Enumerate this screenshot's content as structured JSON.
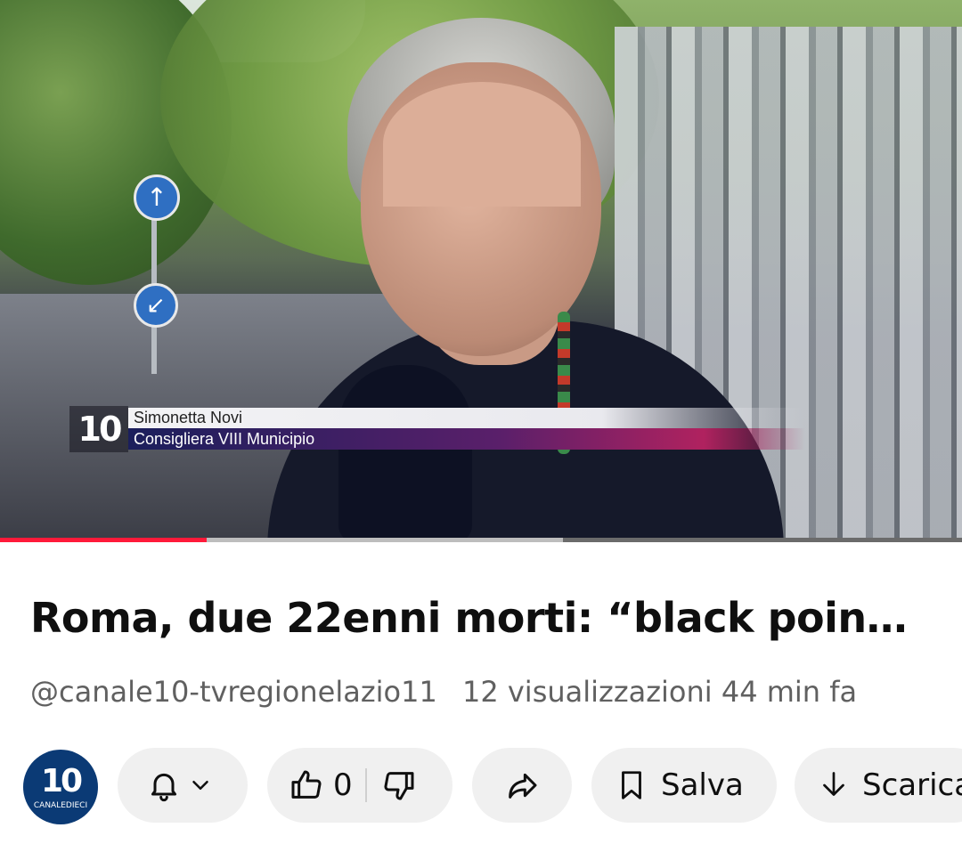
{
  "video": {
    "lower_third": {
      "logo": "10",
      "name": "Simonetta Novi",
      "role": "Consigliera VIII Municipio"
    },
    "progress": {
      "played": 0.215,
      "buffered": 0.585
    }
  },
  "title": "Roma, due 22enni morti: “black poin…",
  "meta": {
    "channel": "@canale10-tvregionelazio11",
    "views": "12 visualizzazioni",
    "time": "44 min fa"
  },
  "channel_avatar": {
    "logo": "10",
    "caption": "CANALEDIECI"
  },
  "actions": {
    "like_count": "0",
    "save_label": "Salva",
    "download_label": "Scarica"
  },
  "colors": {
    "progress_played": "#ff1a3a",
    "pill_bg": "#f0f0f0",
    "meta_text": "#606060"
  }
}
